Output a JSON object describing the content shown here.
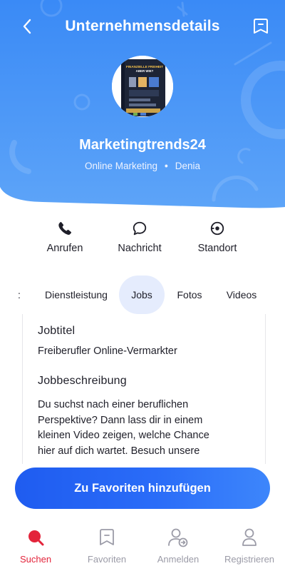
{
  "header": {
    "title": "Unternehmensdetails",
    "back_icon": "chevron-left-icon",
    "bookmark_icon": "bookmark-icon"
  },
  "company": {
    "name": "Marketingtrends24",
    "category": "Online Marketing",
    "separator": "•",
    "location": "Denia",
    "avatar_book_title_line1": "FINANZIELLE FREIHEIT",
    "avatar_book_title_line2": "ABER WIE?"
  },
  "actions": [
    {
      "label": "Anrufen",
      "icon": "phone-icon"
    },
    {
      "label": "Nachricht",
      "icon": "message-icon"
    },
    {
      "label": "Standort",
      "icon": "location-icon"
    }
  ],
  "tabs": {
    "partial": ":",
    "items": [
      "Dienstleistung",
      "Jobs",
      "Fotos",
      "Videos"
    ],
    "active": "Jobs"
  },
  "job": {
    "title_heading": "Jobtitel",
    "title_value": "Freiberufler Online-Vermarkter",
    "desc_heading": "Jobbeschreibung",
    "desc_lines": [
      "Du suchst nach einer beruflichen",
      "Perspektive? Dann lass dir in einem",
      "kleinen Video zeigen, welche Chance",
      "hier auf dich wartet. Besuch unsere"
    ]
  },
  "cta": {
    "label": "Zu Favoriten hinzufügen"
  },
  "bottom_nav": [
    {
      "label": "Suchen",
      "icon": "search-icon",
      "active": true
    },
    {
      "label": "Favoriten",
      "icon": "bookmark-icon",
      "active": false
    },
    {
      "label": "Anmelden",
      "icon": "user-login-icon",
      "active": false
    },
    {
      "label": "Registrieren",
      "icon": "user-icon",
      "active": false
    }
  ],
  "colors": {
    "header_gradient_top": "#3b8cf7",
    "header_gradient_bottom": "#5aa2f8",
    "accent": "#2563f2",
    "tab_active_bg": "#e5ecfd",
    "nav_active": "#e3243b",
    "nav_inactive": "#9b9ba7"
  }
}
